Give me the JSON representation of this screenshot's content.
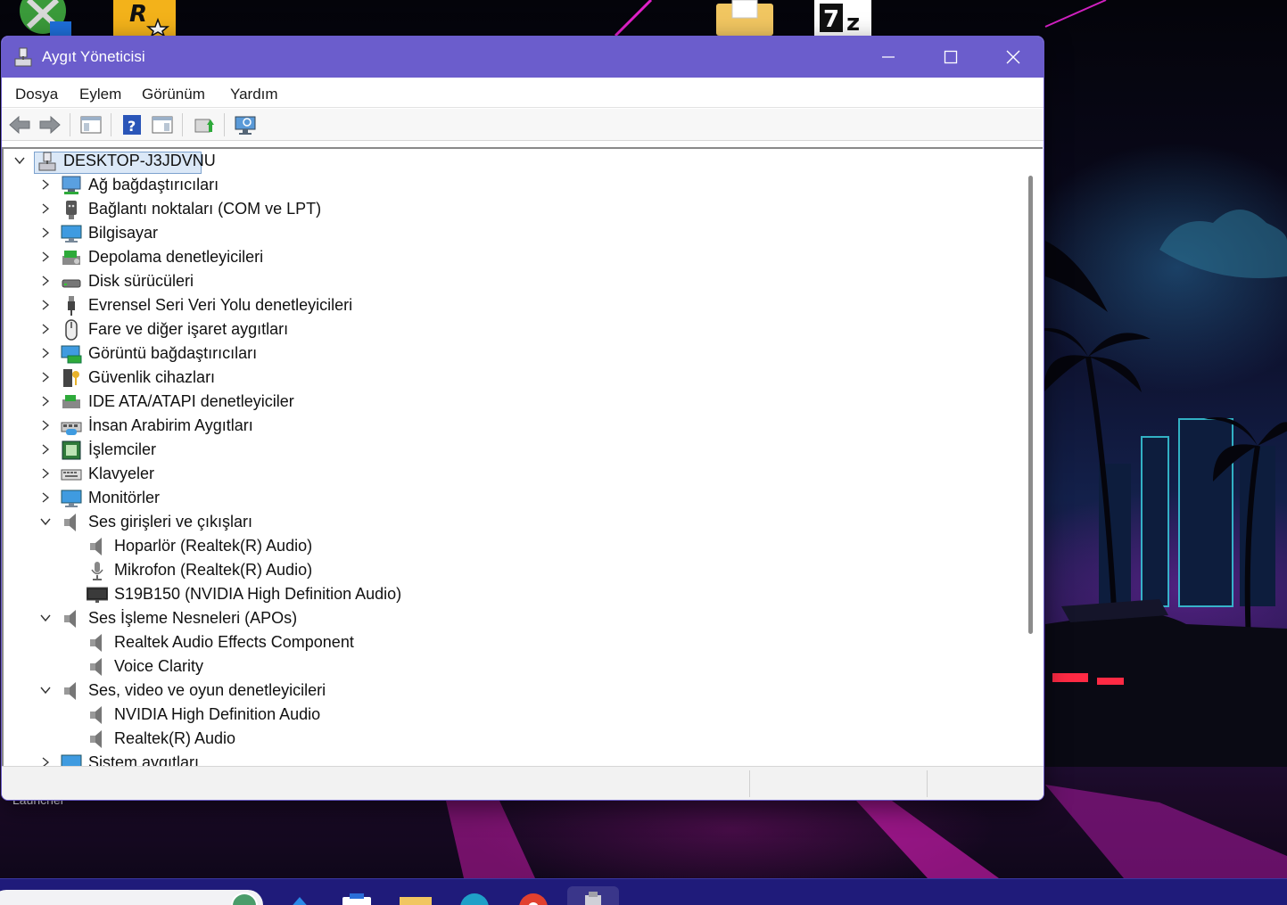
{
  "desktop": {
    "label_partial": "Launcher",
    "icons": [
      "xbox-like-icon",
      "rockstar-launcher-icon",
      "folder-icon",
      "7zip-icon"
    ]
  },
  "window": {
    "title": "Aygıt Yöneticisi",
    "accent_color": "#6b5dcc",
    "menu": [
      "Dosya",
      "Eylem",
      "Görünüm",
      "Yardım"
    ],
    "toolbar": [
      "back-arrow-icon",
      "forward-arrow-icon",
      "show-hide-console-tree-icon",
      "help-icon",
      "properties-pane-icon",
      "update-driver-icon",
      "scan-hardware-icon"
    ]
  },
  "tree": {
    "root": "DESKTOP-J3JDVNU",
    "items": [
      {
        "label": "Ağ bağdaştırıcıları",
        "icon": "network-adapter-icon",
        "expanded": false
      },
      {
        "label": "Bağlantı noktaları (COM ve LPT)",
        "icon": "port-icon",
        "expanded": false
      },
      {
        "label": "Bilgisayar",
        "icon": "computer-monitor-icon",
        "expanded": false
      },
      {
        "label": "Depolama denetleyicileri",
        "icon": "storage-controller-icon",
        "expanded": false
      },
      {
        "label": "Disk sürücüleri",
        "icon": "disk-drive-icon",
        "expanded": false
      },
      {
        "label": "Evrensel Seri Veri Yolu denetleyicileri",
        "icon": "usb-icon",
        "expanded": false
      },
      {
        "label": "Fare ve diğer işaret aygıtları",
        "icon": "mouse-icon",
        "expanded": false
      },
      {
        "label": "Görüntü bağdaştırıcıları",
        "icon": "display-adapter-icon",
        "expanded": false
      },
      {
        "label": "Güvenlik cihazları",
        "icon": "security-device-icon",
        "expanded": false
      },
      {
        "label": "IDE ATA/ATAPI denetleyiciler",
        "icon": "ide-controller-icon",
        "expanded": false
      },
      {
        "label": "İnsan Arabirim Aygıtları",
        "icon": "hid-icon",
        "expanded": false
      },
      {
        "label": "İşlemciler",
        "icon": "processor-icon",
        "expanded": false
      },
      {
        "label": "Klavyeler",
        "icon": "keyboard-icon",
        "expanded": false
      },
      {
        "label": "Monitörler",
        "icon": "monitor-icon",
        "expanded": false
      },
      {
        "label": "Ses girişleri ve çıkışları",
        "icon": "speaker-icon",
        "expanded": true,
        "children": [
          {
            "label": "Hoparlör (Realtek(R) Audio)",
            "icon": "speaker-icon"
          },
          {
            "label": "Mikrofon (Realtek(R) Audio)",
            "icon": "microphone-icon"
          },
          {
            "label": "S19B150 (NVIDIA High Definition Audio)",
            "icon": "monitor-audio-icon"
          }
        ]
      },
      {
        "label": "Ses İşleme Nesneleri (APOs)",
        "icon": "speaker-icon",
        "expanded": true,
        "children": [
          {
            "label": "Realtek Audio Effects Component",
            "icon": "speaker-icon"
          },
          {
            "label": "Voice Clarity",
            "icon": "speaker-icon"
          }
        ]
      },
      {
        "label": "Ses, video ve oyun denetleyicileri",
        "icon": "speaker-icon",
        "expanded": true,
        "children": [
          {
            "label": "NVIDIA High Definition Audio",
            "icon": "speaker-icon"
          },
          {
            "label": "Realtek(R) Audio",
            "icon": "speaker-icon"
          }
        ]
      },
      {
        "label": "Sistem aygıtları",
        "icon": "system-device-icon",
        "expanded": false
      }
    ]
  }
}
